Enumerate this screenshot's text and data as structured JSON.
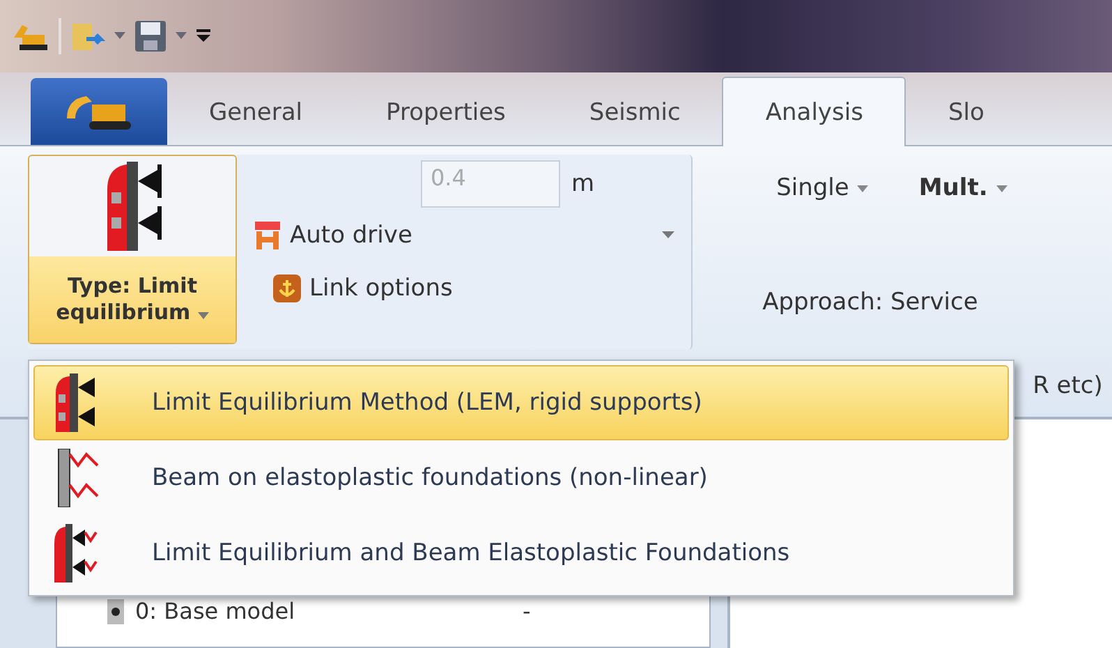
{
  "tabs": [
    {
      "label": "General",
      "selected": false
    },
    {
      "label": "Properties",
      "selected": false
    },
    {
      "label": "Seismic",
      "selected": false
    },
    {
      "label": "Analysis",
      "selected": true
    },
    {
      "label": "Slo",
      "selected": false
    }
  ],
  "ribbon": {
    "type_button": {
      "lines": [
        "Type: Limit",
        "equilibrium"
      ],
      "hovered": true
    },
    "spacing_field": {
      "value": "0.4",
      "unit": "m",
      "disabled": true
    },
    "auto_drive": "Auto drive",
    "link_options": "Link options",
    "single": "Single",
    "mult": "Mult.",
    "approach": "Approach: Service",
    "cut_text": "R etc)"
  },
  "menu": [
    {
      "label": "Limit Equilibrium Method (LEM, rigid supports)",
      "kind": "lem",
      "selected": true
    },
    {
      "label": "Beam on elastoplastic foundations (non-linear)",
      "kind": "beam",
      "selected": false
    },
    {
      "label": "Limit Equilibrium and Beam Elastoplastic Foundations",
      "kind": "combined",
      "selected": false
    }
  ],
  "tree": {
    "row": "0: Base model",
    "column_2": "-"
  }
}
